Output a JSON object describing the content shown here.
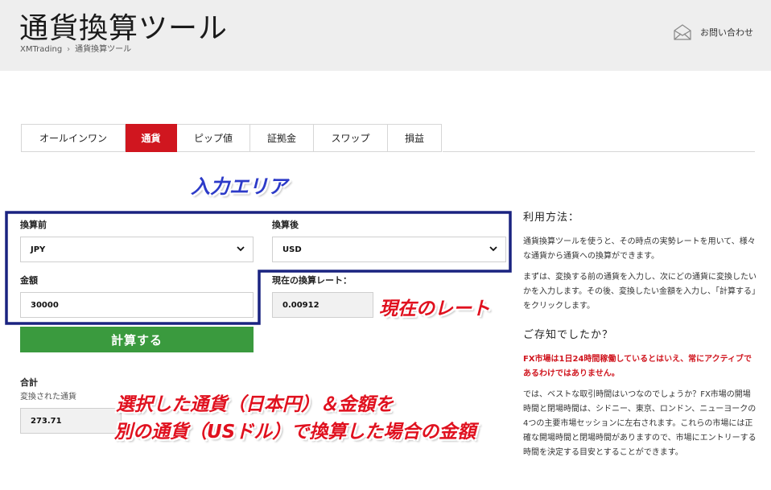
{
  "header": {
    "title": "通貨換算ツール",
    "breadcrumb": [
      "XMTrading",
      "通貨換算ツール"
    ],
    "breadcrumb_separator": "›",
    "contact_label": "お問い合わせ"
  },
  "tabs": [
    {
      "label": "オールインワン",
      "active": false
    },
    {
      "label": "通貨",
      "active": true
    },
    {
      "label": "ピップ値",
      "active": false
    },
    {
      "label": "証拠金",
      "active": false
    },
    {
      "label": "スワップ",
      "active": false
    },
    {
      "label": "損益",
      "active": false
    }
  ],
  "form": {
    "from_label": "換算前",
    "from_value": "JPY",
    "to_label": "換算後",
    "to_value": "USD",
    "amount_label": "金額",
    "amount_value": "30000",
    "rate_label": "現在の換算レート：",
    "rate_value": "0.00912",
    "calc_button": "計算する",
    "total_label": "合計",
    "total_sublabel": "変換された通貨",
    "total_value": "273.71"
  },
  "annotations": {
    "input_area": "入力エリア",
    "current_rate": "現在のレート",
    "result_line1": "選択した通貨（日本円）＆金額を",
    "result_line2": "別の通貨（USドル）で換算した場合の金額"
  },
  "sidebar": {
    "usage_title": "利用方法：",
    "usage_p1": "通貨換算ツールを使うと、その時点の実勢レートを用いて、様々な通貨から通貨への換算ができます。",
    "usage_p2": "まずは、変換する前の通貨を入力し、次にどの通貨に変換したいかを入力します。その後、変換したい金額を入力し、「計算する」をクリックします。",
    "know_title": "ご存知でしたか？",
    "know_alert": "FX市場は1日24時間稼働しているとはいえ、常にアクティブであるわけではありません。",
    "know_p": "では、ベストな取引時間はいつなのでしょうか？FX市場の開場時間と閉場時間は、シドニー、東京、ロンドン、ニューヨークの4つの主要市場セッションに左右されます。これらの市場には正確な開場時間と閉場時間がありますので、市場にエントリーする時間を決定する目安とすることができます。"
  },
  "colors": {
    "accent_red": "#d0161f",
    "button_green": "#3a9a3e",
    "highlight_navy": "#1a2380",
    "callout_blue": "#2c3ac8"
  }
}
